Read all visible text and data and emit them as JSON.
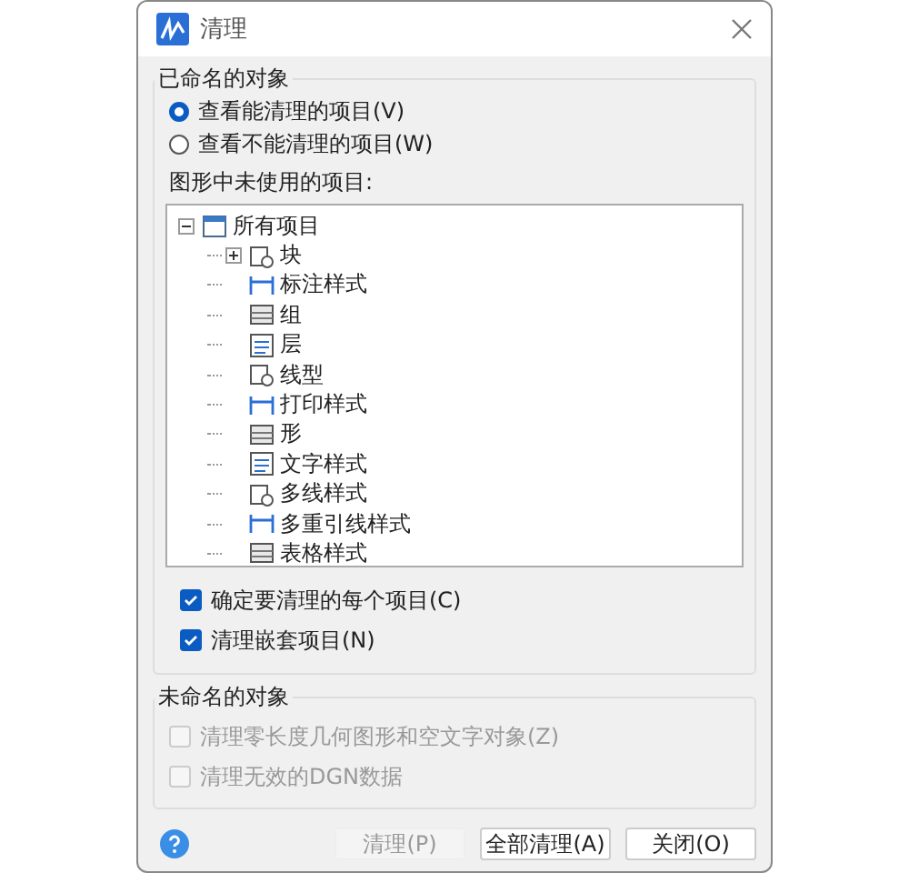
{
  "window": {
    "title": "清理"
  },
  "named_group": {
    "label": "已命名的对象",
    "radios": [
      {
        "label": "查看能清理的项目(V)",
        "selected": true
      },
      {
        "label": "查看不能清理的项目(W)",
        "selected": false
      }
    ],
    "tree_label": "图形中未使用的项目:",
    "tree": {
      "label": "所有项目",
      "expanded": true,
      "children": [
        {
          "label": "块",
          "expandable": true
        },
        {
          "label": "标注样式",
          "expandable": false
        },
        {
          "label": "组",
          "expandable": false
        },
        {
          "label": "层",
          "expandable": false
        },
        {
          "label": "线型",
          "expandable": false
        },
        {
          "label": "打印样式",
          "expandable": false
        },
        {
          "label": "形",
          "expandable": false
        },
        {
          "label": "文字样式",
          "expandable": false
        },
        {
          "label": "多线样式",
          "expandable": false
        },
        {
          "label": "多重引线样式",
          "expandable": false
        },
        {
          "label": "表格样式",
          "expandable": false
        }
      ]
    },
    "checkboxes": [
      {
        "label": "确定要清理的每个项目(C)",
        "checked": true,
        "disabled": false
      },
      {
        "label": "清理嵌套项目(N)",
        "checked": true,
        "disabled": false
      }
    ]
  },
  "unnamed_group": {
    "label": "未命名的对象",
    "checkboxes": [
      {
        "label": "清理零长度几何图形和空文字对象(Z)",
        "checked": false,
        "disabled": true
      },
      {
        "label": "清理无效的DGN数据",
        "checked": false,
        "disabled": true
      }
    ]
  },
  "buttons": [
    {
      "label": "清理(P)",
      "disabled": true
    },
    {
      "label": "全部清理(A)",
      "disabled": false
    },
    {
      "label": "关闭(O)",
      "disabled": false
    }
  ]
}
